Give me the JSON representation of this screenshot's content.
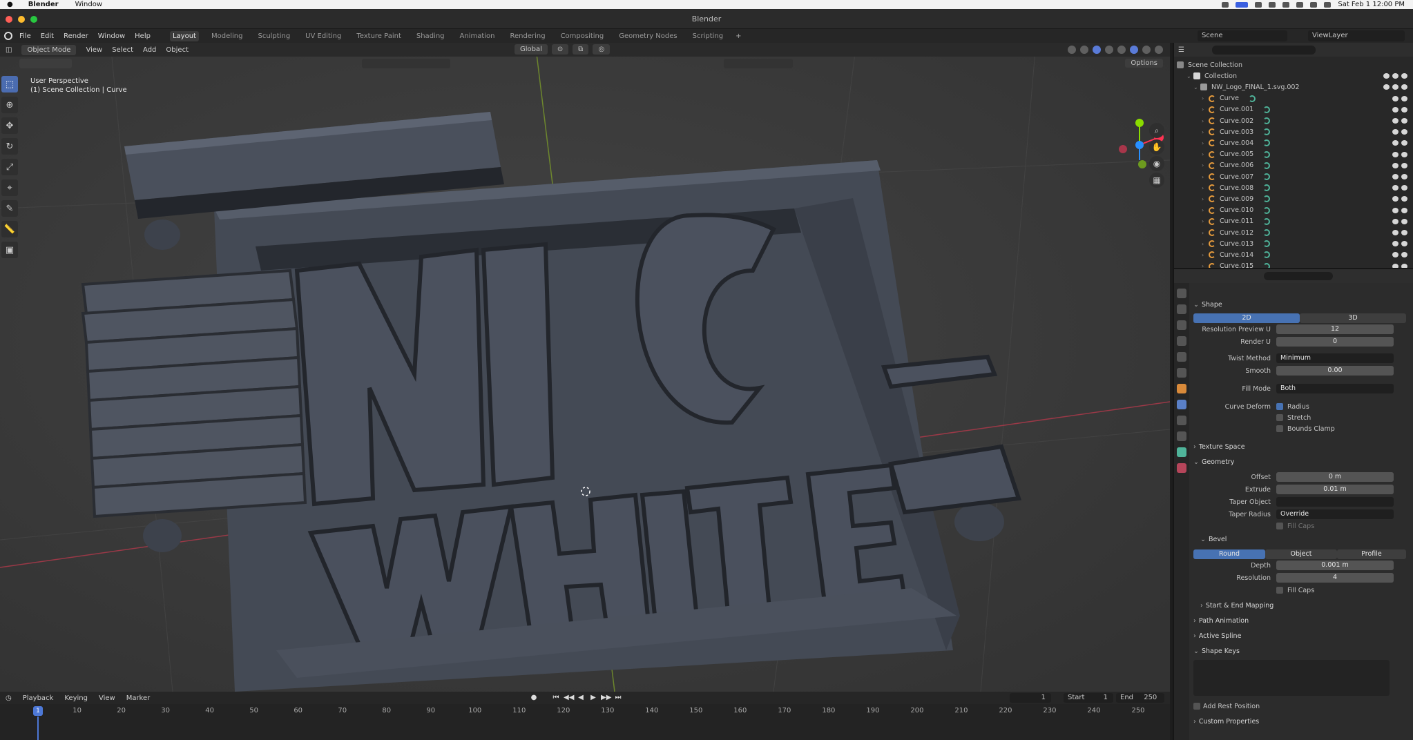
{
  "macbar": {
    "app": "Blender",
    "menu": "Window",
    "datetime": "Sat Feb 1  12:00 PM"
  },
  "window": {
    "title": "Blender"
  },
  "menus": [
    "File",
    "Edit",
    "Render",
    "Window",
    "Help"
  ],
  "workspaces": [
    {
      "label": "Layout",
      "active": true
    },
    {
      "label": "Modeling"
    },
    {
      "label": "Sculpting"
    },
    {
      "label": "UV Editing"
    },
    {
      "label": "Texture Paint"
    },
    {
      "label": "Shading"
    },
    {
      "label": "Animation"
    },
    {
      "label": "Rendering"
    },
    {
      "label": "Compositing"
    },
    {
      "label": "Geometry Nodes"
    },
    {
      "label": "Scripting"
    }
  ],
  "workspace_add": "+",
  "scene_selector": "Scene",
  "viewlayer_selector": "ViewLayer",
  "viewport": {
    "mode": "Object Mode",
    "header_menus": [
      "View",
      "Select",
      "Add",
      "Object"
    ],
    "orientation": "Global",
    "options": "Options",
    "info_line1": "User Perspective",
    "info_line2": "(1) Scene Collection | Curve",
    "logo_text_top": "NIC",
    "logo_text_bottom": "WHITE",
    "axis_x_color": "#ff3352",
    "axis_y_color": "#8bdc00",
    "axis_z_color": "#2890ff"
  },
  "outliner": {
    "root": "Scene Collection",
    "collection": "Collection",
    "object_parent": "NW_Logo_FINAL_1.svg.002",
    "items": [
      "Curve",
      "Curve.001",
      "Curve.002",
      "Curve.003",
      "Curve.004",
      "Curve.005",
      "Curve.006",
      "Curve.007",
      "Curve.008",
      "Curve.009",
      "Curve.010",
      "Curve.011",
      "Curve.012",
      "Curve.013",
      "Curve.014",
      "Curve.015"
    ]
  },
  "properties": {
    "shape": {
      "title": "Shape",
      "dim_2d": "2D",
      "dim_3d": "3D",
      "res_preview_label": "Resolution Preview U",
      "res_preview_value": "12",
      "render_u_label": "Render U",
      "render_u_value": "0",
      "twist_label": "Twist Method",
      "twist_value": "Minimum",
      "smooth_label": "Smooth",
      "smooth_value": "0.00",
      "fill_label": "Fill Mode",
      "fill_value": "Both",
      "deform_label": "Curve Deform",
      "radius_label": "Radius",
      "stretch_label": "Stretch",
      "bounds_label": "Bounds Clamp"
    },
    "texture_space": "Texture Space",
    "geometry": {
      "title": "Geometry",
      "offset_label": "Offset",
      "offset_value": "0 m",
      "extrude_label": "Extrude",
      "extrude_value": "0.01 m",
      "taper_obj_label": "Taper Object",
      "taper_radius_label": "Taper Radius",
      "taper_radius_value": "Override",
      "fill_caps_taper": "Fill Caps"
    },
    "bevel": {
      "title": "Bevel",
      "round": "Round",
      "object": "Object",
      "profile": "Profile",
      "depth_label": "Depth",
      "depth_value": "0.001 m",
      "resolution_label": "Resolution",
      "resolution_value": "4",
      "fill_caps": "Fill Caps"
    },
    "start_end": "Start & End Mapping",
    "path_anim": "Path Animation",
    "active_spline": "Active Spline",
    "shape_keys": "Shape Keys",
    "add_rest": "Add Rest Position",
    "custom_props": "Custom Properties"
  },
  "timeline": {
    "menus": [
      "Playback",
      "Keying",
      "View",
      "Marker"
    ],
    "current_frame": "1",
    "start_label": "Start",
    "start_value": "1",
    "end_label": "End",
    "end_value": "250",
    "playhead": "1",
    "ticks": [
      "10",
      "20",
      "30",
      "40",
      "50",
      "60",
      "70",
      "80",
      "90",
      "100",
      "110",
      "120",
      "130",
      "140",
      "150",
      "160",
      "170",
      "180",
      "190",
      "200",
      "210",
      "220",
      "230",
      "240",
      "250"
    ]
  }
}
